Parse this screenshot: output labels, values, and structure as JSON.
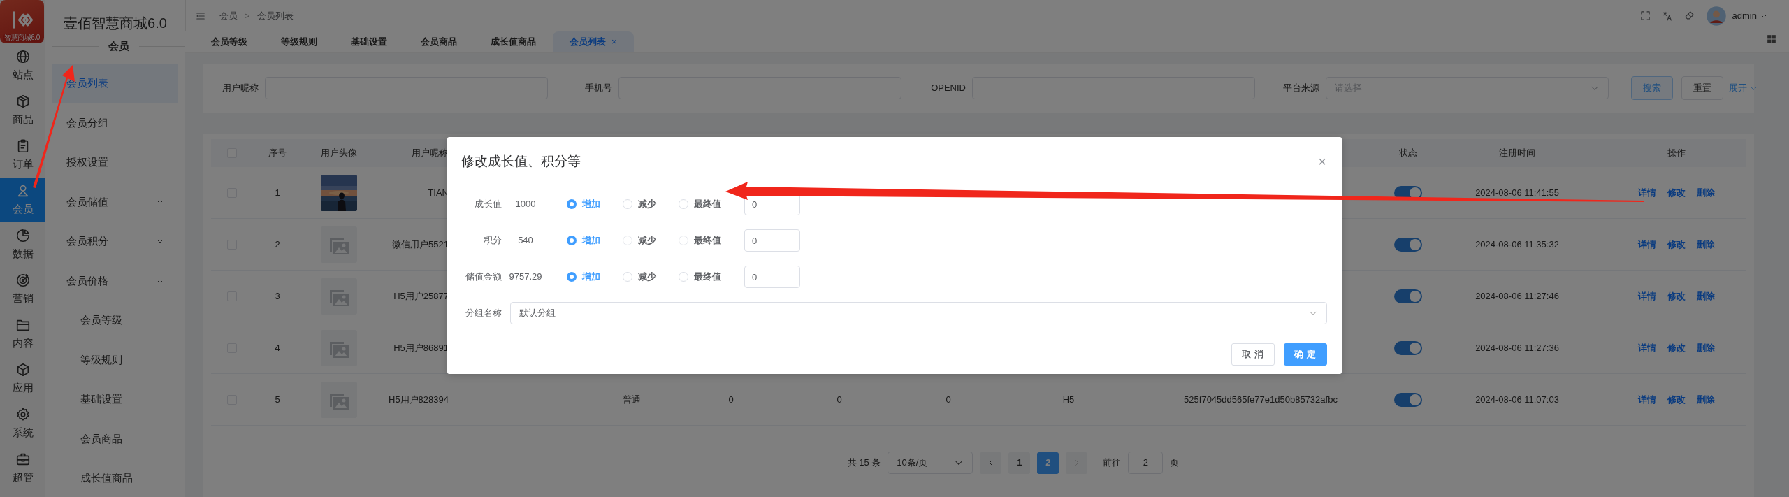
{
  "logo": {
    "caption": "智慧商城6.0"
  },
  "rail": [
    {
      "label": "站点",
      "kind": "globe",
      "selected": false
    },
    {
      "label": "商品",
      "kind": "box",
      "selected": false
    },
    {
      "label": "订单",
      "kind": "clipboard",
      "selected": false
    },
    {
      "label": "会员",
      "kind": "user",
      "selected": true
    },
    {
      "label": "数据",
      "kind": "pie",
      "selected": false
    },
    {
      "label": "营销",
      "kind": "target",
      "selected": false
    },
    {
      "label": "内容",
      "kind": "folder",
      "selected": false
    },
    {
      "label": "应用",
      "kind": "cube",
      "selected": false
    },
    {
      "label": "系统",
      "kind": "gear",
      "selected": false
    },
    {
      "label": "超管",
      "kind": "toolbox",
      "selected": false
    }
  ],
  "sidebar": {
    "title": "壹佰智慧商城6.0",
    "section": "会员",
    "items": [
      {
        "label": "会员列表",
        "kind": "link",
        "selected": true
      },
      {
        "label": "会员分组",
        "kind": "link",
        "selected": false
      },
      {
        "label": "授权设置",
        "kind": "link",
        "selected": false
      },
      {
        "label": "会员储值",
        "kind": "group",
        "selected": false,
        "expanded": false
      },
      {
        "label": "会员积分",
        "kind": "group",
        "selected": false,
        "expanded": false
      },
      {
        "label": "会员价格",
        "kind": "group",
        "selected": false,
        "expanded": true,
        "children": [
          {
            "label": "会员等级",
            "selected": false
          },
          {
            "label": "等级规则",
            "selected": false
          },
          {
            "label": "基础设置",
            "selected": false
          },
          {
            "label": "会员商品",
            "selected": false
          },
          {
            "label": "成长值商品",
            "selected": false
          }
        ]
      }
    ]
  },
  "header": {
    "breadcrumb": [
      "会员",
      "会员列表"
    ],
    "breadcrumb_separator": ">",
    "user": "admin"
  },
  "tabs": [
    {
      "label": "会员等级",
      "selected": false
    },
    {
      "label": "等级规则",
      "selected": false
    },
    {
      "label": "基础设置",
      "selected": false
    },
    {
      "label": "会员商品",
      "selected": false
    },
    {
      "label": "成长值商品",
      "selected": false
    },
    {
      "label": "会员列表",
      "selected": true,
      "close": "×"
    }
  ],
  "filters": [
    {
      "label": "用户昵称",
      "kind": "input"
    },
    {
      "label": "手机号",
      "kind": "input"
    },
    {
      "label": "OPENID",
      "kind": "input"
    },
    {
      "label": "平台来源",
      "kind": "select",
      "placeholder": "请选择"
    }
  ],
  "filter_buttons": {
    "search": "搜索",
    "reset": "重置",
    "expand": "展开"
  },
  "table": {
    "columns": [
      {
        "kind": "checkbox",
        "checked": false
      },
      {
        "label": "序号"
      },
      {
        "label": "用户头像"
      },
      {
        "label": "用户昵称"
      },
      {},
      {},
      {},
      {},
      {},
      {},
      {},
      {
        "label": "状态"
      },
      {
        "label": "注册时间"
      },
      {
        "label": "操作"
      }
    ],
    "rows": [
      {
        "checked": false,
        "index": "1",
        "avatar": {
          "kind": "picture"
        },
        "nickname": "TIAN",
        "status_on": true,
        "registered": "2024-08-06 11:41:55",
        "actions": [
          "详情",
          "修改",
          "删除"
        ]
      },
      {
        "checked": false,
        "index": "2",
        "avatar": {
          "kind": "placeholder"
        },
        "nickname": "微信用户5521",
        "status_on": true,
        "registered": "2024-08-06 11:35:32",
        "actions": [
          "详情",
          "修改",
          "删除"
        ]
      },
      {
        "checked": false,
        "index": "3",
        "avatar": {
          "kind": "placeholder"
        },
        "nickname": "H5用户25877",
        "status_on": true,
        "registered": "2024-08-06 11:27:46",
        "actions": [
          "详情",
          "修改",
          "删除"
        ]
      },
      {
        "checked": false,
        "index": "4",
        "avatar": {
          "kind": "placeholder"
        },
        "nickname": "H5用户86891",
        "status_on": true,
        "registered": "2024-08-06 11:27:36",
        "actions": [
          "详情",
          "修改",
          "删除"
        ]
      },
      {
        "checked": false,
        "index": "5",
        "avatar": {
          "kind": "placeholder"
        },
        "nickname": "H5用户828394",
        "cells": [
          "普通",
          "0",
          "0",
          "0",
          "H5",
          "525f7045dd565fe77e1d50b85732afbc"
        ],
        "status_on": true,
        "registered": "2024-08-06 11:07:03",
        "actions": [
          "详情",
          "修改",
          "删除"
        ]
      }
    ]
  },
  "pagination": {
    "total": "共 15 条",
    "page_size": "10条/页",
    "pages": [
      {
        "label": "1",
        "selected": false
      },
      {
        "label": "2",
        "selected": true
      }
    ],
    "goto_label": "前往",
    "goto_value": "2",
    "goto_suffix": "页"
  },
  "modal": {
    "title": "修改成长值、积分等",
    "close": "×",
    "fields": [
      {
        "label": "成长值",
        "current": "1000",
        "options": [
          {
            "label": "增加",
            "selected": true
          },
          {
            "label": "减少",
            "selected": false
          },
          {
            "label": "最终值",
            "selected": false
          }
        ],
        "value": "0"
      },
      {
        "label": "积分",
        "current": "540",
        "options": [
          {
            "label": "增加",
            "selected": true
          },
          {
            "label": "减少",
            "selected": false
          },
          {
            "label": "最终值",
            "selected": false
          }
        ],
        "value": "0"
      },
      {
        "label": "储值金额",
        "current": "9757.29",
        "options": [
          {
            "label": "增加",
            "selected": true
          },
          {
            "label": "减少",
            "selected": false
          },
          {
            "label": "最终值",
            "selected": false
          }
        ],
        "value": "0"
      }
    ],
    "group": {
      "label": "分组名称",
      "value": "默认分组"
    },
    "buttons": [
      {
        "label": "取 消",
        "kind": "default"
      },
      {
        "label": "确 定",
        "kind": "primary"
      }
    ]
  },
  "annotations": [
    {
      "kind": "arrow"
    },
    {
      "kind": "arrow"
    }
  ]
}
